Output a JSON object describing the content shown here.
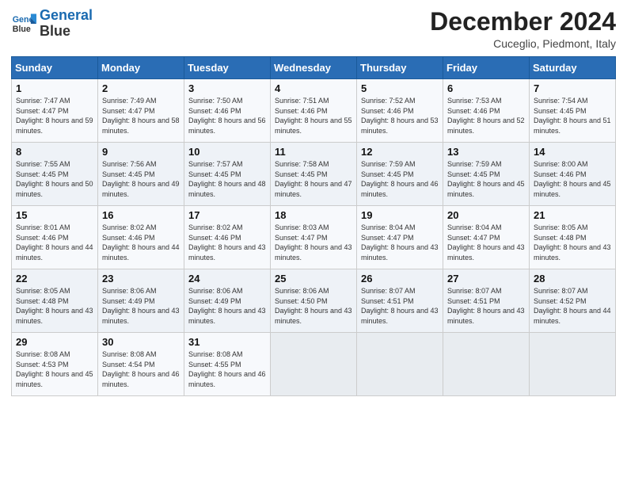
{
  "header": {
    "logo_line1": "General",
    "logo_line2": "Blue",
    "month": "December 2024",
    "location": "Cuceglio, Piedmont, Italy"
  },
  "weekdays": [
    "Sunday",
    "Monday",
    "Tuesday",
    "Wednesday",
    "Thursday",
    "Friday",
    "Saturday"
  ],
  "weeks": [
    [
      {
        "day": "1",
        "sunrise": "Sunrise: 7:47 AM",
        "sunset": "Sunset: 4:47 PM",
        "daylight": "Daylight: 8 hours and 59 minutes."
      },
      {
        "day": "2",
        "sunrise": "Sunrise: 7:49 AM",
        "sunset": "Sunset: 4:47 PM",
        "daylight": "Daylight: 8 hours and 58 minutes."
      },
      {
        "day": "3",
        "sunrise": "Sunrise: 7:50 AM",
        "sunset": "Sunset: 4:46 PM",
        "daylight": "Daylight: 8 hours and 56 minutes."
      },
      {
        "day": "4",
        "sunrise": "Sunrise: 7:51 AM",
        "sunset": "Sunset: 4:46 PM",
        "daylight": "Daylight: 8 hours and 55 minutes."
      },
      {
        "day": "5",
        "sunrise": "Sunrise: 7:52 AM",
        "sunset": "Sunset: 4:46 PM",
        "daylight": "Daylight: 8 hours and 53 minutes."
      },
      {
        "day": "6",
        "sunrise": "Sunrise: 7:53 AM",
        "sunset": "Sunset: 4:46 PM",
        "daylight": "Daylight: 8 hours and 52 minutes."
      },
      {
        "day": "7",
        "sunrise": "Sunrise: 7:54 AM",
        "sunset": "Sunset: 4:45 PM",
        "daylight": "Daylight: 8 hours and 51 minutes."
      }
    ],
    [
      {
        "day": "8",
        "sunrise": "Sunrise: 7:55 AM",
        "sunset": "Sunset: 4:45 PM",
        "daylight": "Daylight: 8 hours and 50 minutes."
      },
      {
        "day": "9",
        "sunrise": "Sunrise: 7:56 AM",
        "sunset": "Sunset: 4:45 PM",
        "daylight": "Daylight: 8 hours and 49 minutes."
      },
      {
        "day": "10",
        "sunrise": "Sunrise: 7:57 AM",
        "sunset": "Sunset: 4:45 PM",
        "daylight": "Daylight: 8 hours and 48 minutes."
      },
      {
        "day": "11",
        "sunrise": "Sunrise: 7:58 AM",
        "sunset": "Sunset: 4:45 PM",
        "daylight": "Daylight: 8 hours and 47 minutes."
      },
      {
        "day": "12",
        "sunrise": "Sunrise: 7:59 AM",
        "sunset": "Sunset: 4:45 PM",
        "daylight": "Daylight: 8 hours and 46 minutes."
      },
      {
        "day": "13",
        "sunrise": "Sunrise: 7:59 AM",
        "sunset": "Sunset: 4:45 PM",
        "daylight": "Daylight: 8 hours and 45 minutes."
      },
      {
        "day": "14",
        "sunrise": "Sunrise: 8:00 AM",
        "sunset": "Sunset: 4:46 PM",
        "daylight": "Daylight: 8 hours and 45 minutes."
      }
    ],
    [
      {
        "day": "15",
        "sunrise": "Sunrise: 8:01 AM",
        "sunset": "Sunset: 4:46 PM",
        "daylight": "Daylight: 8 hours and 44 minutes."
      },
      {
        "day": "16",
        "sunrise": "Sunrise: 8:02 AM",
        "sunset": "Sunset: 4:46 PM",
        "daylight": "Daylight: 8 hours and 44 minutes."
      },
      {
        "day": "17",
        "sunrise": "Sunrise: 8:02 AM",
        "sunset": "Sunset: 4:46 PM",
        "daylight": "Daylight: 8 hours and 43 minutes."
      },
      {
        "day": "18",
        "sunrise": "Sunrise: 8:03 AM",
        "sunset": "Sunset: 4:47 PM",
        "daylight": "Daylight: 8 hours and 43 minutes."
      },
      {
        "day": "19",
        "sunrise": "Sunrise: 8:04 AM",
        "sunset": "Sunset: 4:47 PM",
        "daylight": "Daylight: 8 hours and 43 minutes."
      },
      {
        "day": "20",
        "sunrise": "Sunrise: 8:04 AM",
        "sunset": "Sunset: 4:47 PM",
        "daylight": "Daylight: 8 hours and 43 minutes."
      },
      {
        "day": "21",
        "sunrise": "Sunrise: 8:05 AM",
        "sunset": "Sunset: 4:48 PM",
        "daylight": "Daylight: 8 hours and 43 minutes."
      }
    ],
    [
      {
        "day": "22",
        "sunrise": "Sunrise: 8:05 AM",
        "sunset": "Sunset: 4:48 PM",
        "daylight": "Daylight: 8 hours and 43 minutes."
      },
      {
        "day": "23",
        "sunrise": "Sunrise: 8:06 AM",
        "sunset": "Sunset: 4:49 PM",
        "daylight": "Daylight: 8 hours and 43 minutes."
      },
      {
        "day": "24",
        "sunrise": "Sunrise: 8:06 AM",
        "sunset": "Sunset: 4:49 PM",
        "daylight": "Daylight: 8 hours and 43 minutes."
      },
      {
        "day": "25",
        "sunrise": "Sunrise: 8:06 AM",
        "sunset": "Sunset: 4:50 PM",
        "daylight": "Daylight: 8 hours and 43 minutes."
      },
      {
        "day": "26",
        "sunrise": "Sunrise: 8:07 AM",
        "sunset": "Sunset: 4:51 PM",
        "daylight": "Daylight: 8 hours and 43 minutes."
      },
      {
        "day": "27",
        "sunrise": "Sunrise: 8:07 AM",
        "sunset": "Sunset: 4:51 PM",
        "daylight": "Daylight: 8 hours and 43 minutes."
      },
      {
        "day": "28",
        "sunrise": "Sunrise: 8:07 AM",
        "sunset": "Sunset: 4:52 PM",
        "daylight": "Daylight: 8 hours and 44 minutes."
      }
    ],
    [
      {
        "day": "29",
        "sunrise": "Sunrise: 8:08 AM",
        "sunset": "Sunset: 4:53 PM",
        "daylight": "Daylight: 8 hours and 45 minutes."
      },
      {
        "day": "30",
        "sunrise": "Sunrise: 8:08 AM",
        "sunset": "Sunset: 4:54 PM",
        "daylight": "Daylight: 8 hours and 46 minutes."
      },
      {
        "day": "31",
        "sunrise": "Sunrise: 8:08 AM",
        "sunset": "Sunset: 4:55 PM",
        "daylight": "Daylight: 8 hours and 46 minutes."
      },
      null,
      null,
      null,
      null
    ]
  ]
}
